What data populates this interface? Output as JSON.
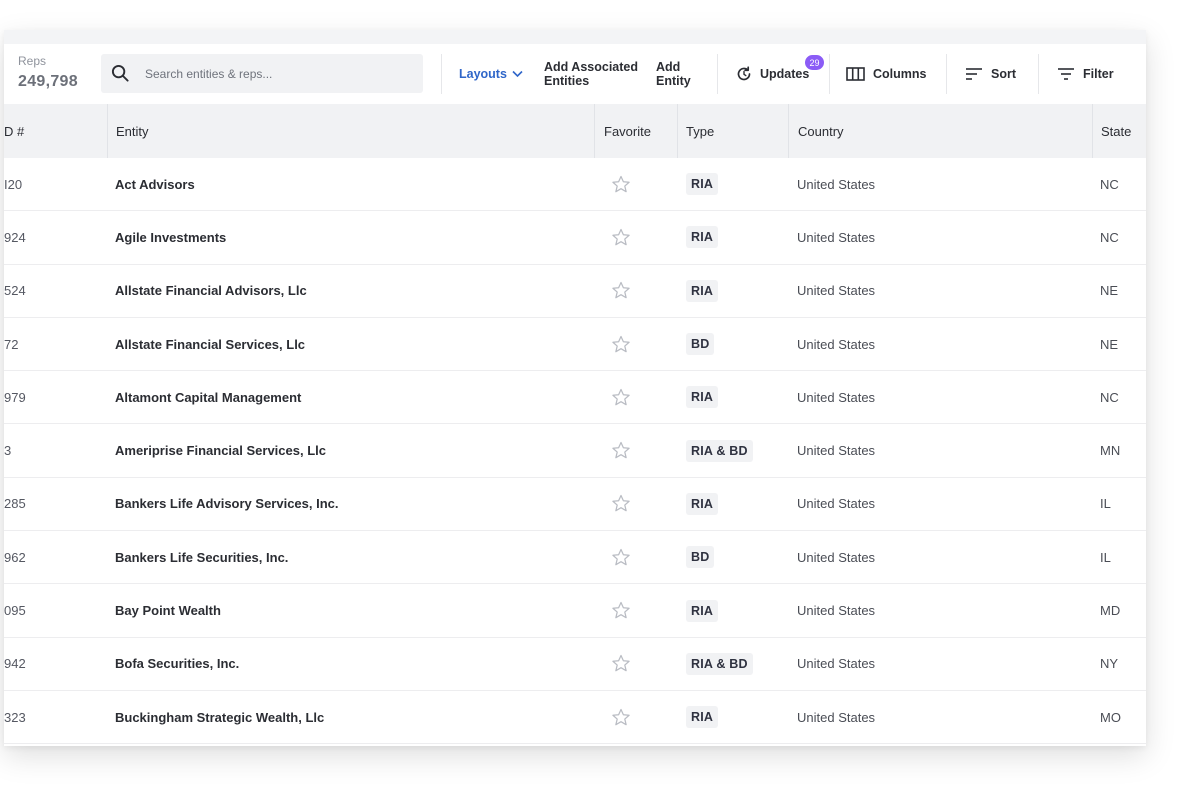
{
  "stats": {
    "reps_label": "Reps",
    "reps_count": "249,798"
  },
  "search": {
    "placeholder": "Search entities & reps..."
  },
  "toolbar": {
    "layouts_label": "Layouts",
    "add_associated_line1": "Add Associated",
    "add_associated_line2": "Entities",
    "add_entity_line1": "Add",
    "add_entity_line2": "Entity",
    "updates_label": "Updates",
    "updates_badge": "29",
    "columns_label": "Columns",
    "sort_label": "Sort",
    "filter_label": "Filter"
  },
  "colors": {
    "accent": "#2f66c9",
    "badge": "#8b5cf6"
  },
  "table": {
    "headers": {
      "id": "D #",
      "entity": "Entity",
      "favorite": "Favorite",
      "type": "Type",
      "country": "Country",
      "state": "State"
    },
    "rows": [
      {
        "id": "I20",
        "entity": "Act Advisors",
        "type": "RIA",
        "country": "United States",
        "state": "NC"
      },
      {
        "id": "924",
        "entity": "Agile Investments",
        "type": "RIA",
        "country": "United States",
        "state": "NC"
      },
      {
        "id": "524",
        "entity": "Allstate Financial Advisors, Llc",
        "type": "RIA",
        "country": "United States",
        "state": "NE"
      },
      {
        "id": "72",
        "entity": "Allstate Financial Services, Llc",
        "type": "BD",
        "country": "United States",
        "state": "NE"
      },
      {
        "id": "979",
        "entity": "Altamont Capital Management",
        "type": "RIA",
        "country": "United States",
        "state": "NC"
      },
      {
        "id": "3",
        "entity": "Ameriprise Financial Services, Llc",
        "type": "RIA & BD",
        "country": "United States",
        "state": "MN"
      },
      {
        "id": "285",
        "entity": "Bankers Life Advisory Services, Inc.",
        "type": "RIA",
        "country": "United States",
        "state": "IL"
      },
      {
        "id": "962",
        "entity": "Bankers Life Securities, Inc.",
        "type": "BD",
        "country": "United States",
        "state": "IL"
      },
      {
        "id": "095",
        "entity": "Bay Point Wealth",
        "type": "RIA",
        "country": "United States",
        "state": "MD"
      },
      {
        "id": "942",
        "entity": "Bofa Securities, Inc.",
        "type": "RIA & BD",
        "country": "United States",
        "state": "NY"
      },
      {
        "id": "323",
        "entity": "Buckingham Strategic Wealth, Llc",
        "type": "RIA",
        "country": "United States",
        "state": "MO"
      }
    ]
  },
  "icons": {
    "search": "search-icon",
    "layouts": "chevron-down-icon",
    "updates": "refresh-icon",
    "columns": "columns-icon",
    "sort": "sort-icon",
    "filter": "filter-icon",
    "favorite": "star-outline-icon"
  }
}
